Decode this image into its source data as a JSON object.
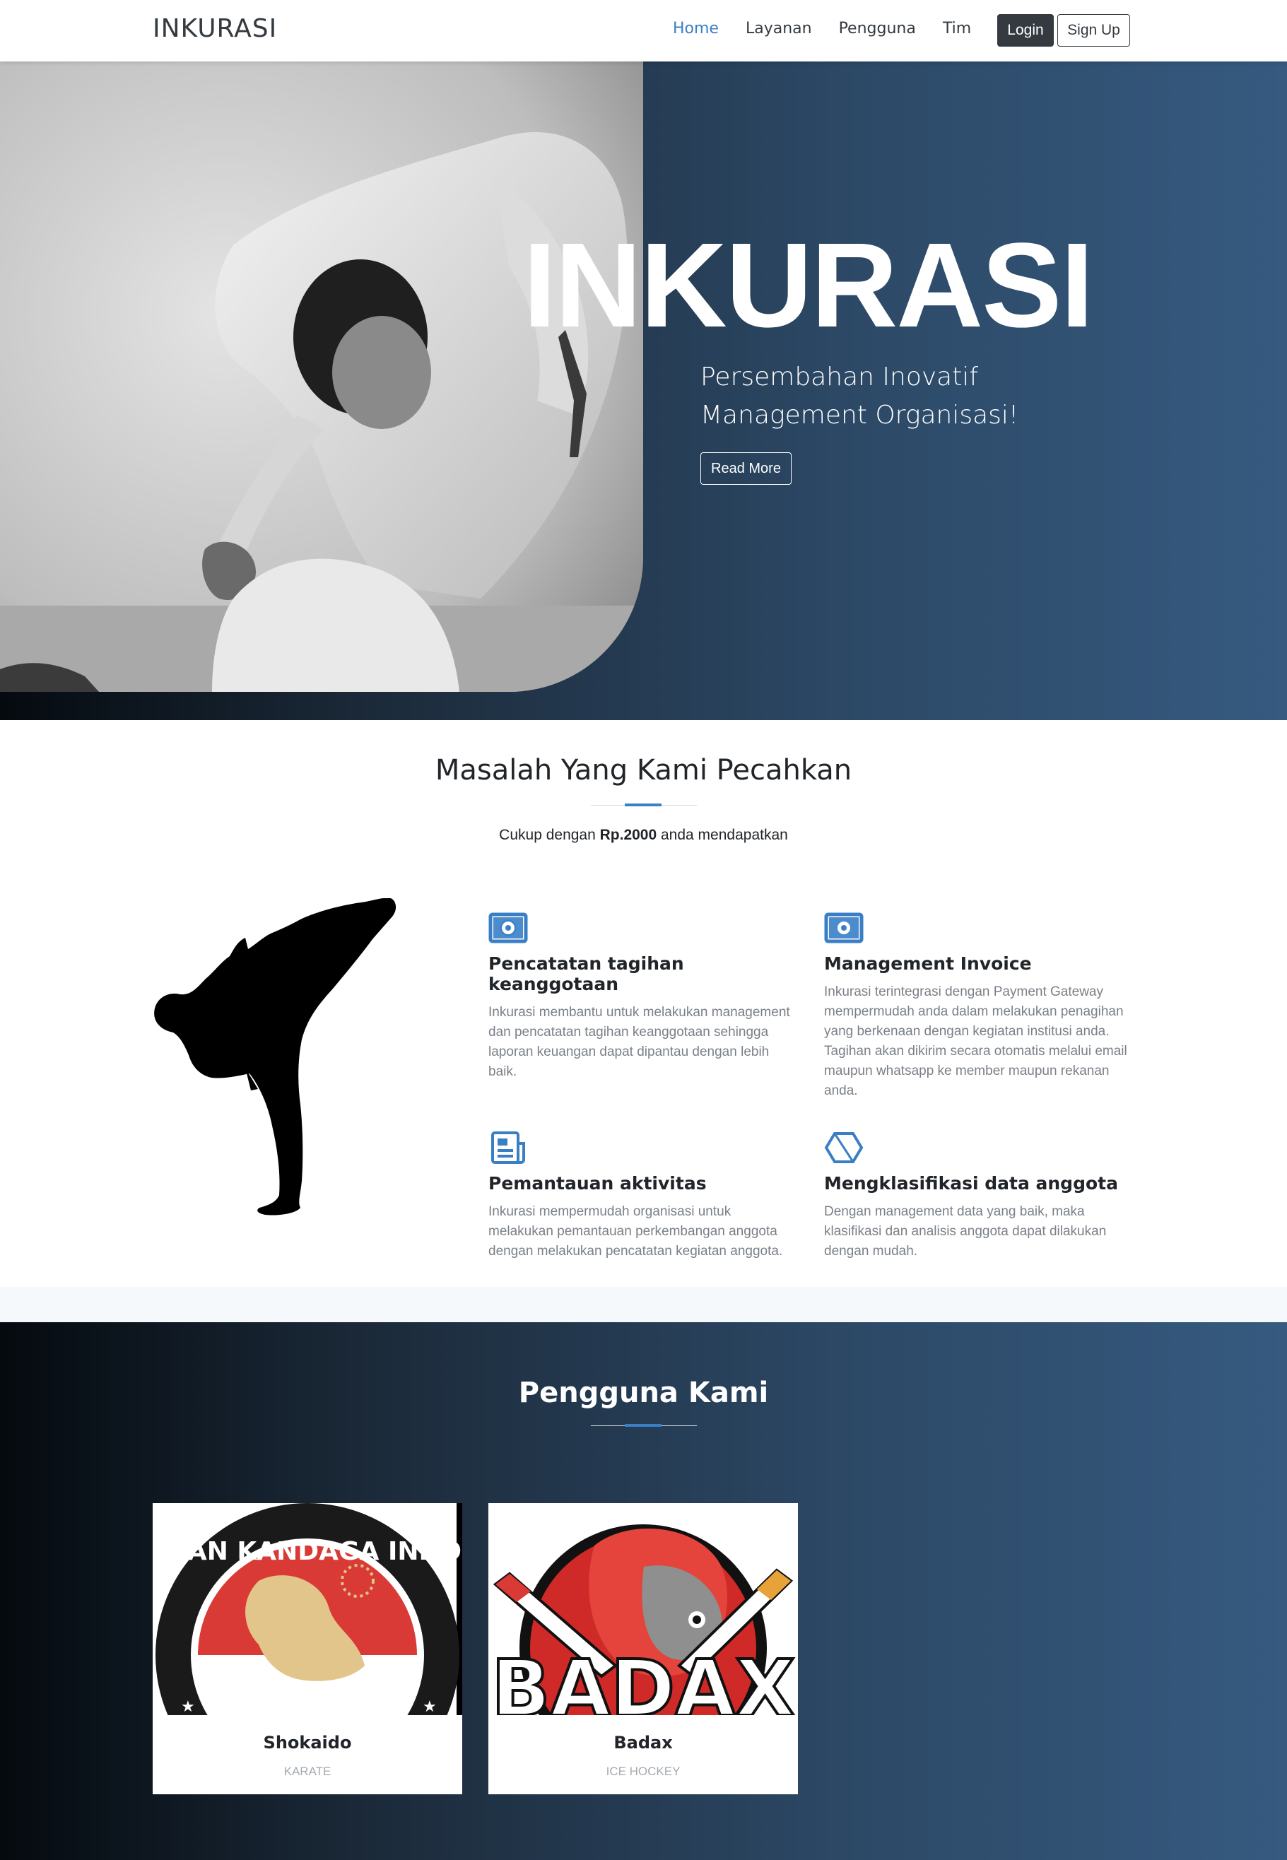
{
  "navbar": {
    "brand": "INKURASI",
    "links": [
      "Home",
      "Layanan",
      "Pengguna",
      "Tim"
    ],
    "active": "Home",
    "login_label": "Login",
    "signup_label": "Sign Up"
  },
  "hero": {
    "title": "INKURASI",
    "subtitle": "Persembahan Inovatif Management Organisasi!",
    "button_label": "Read More"
  },
  "problems": {
    "title": "Masalah Yang Kami Pecahkan",
    "lead_prefix": "Cukup dengan ",
    "lead_price": "Rp.2000",
    "lead_suffix": " anda mendapatkan",
    "features": [
      {
        "icon": "money-icon",
        "title": "Pencatatan tagihan keanggotaan",
        "text": "Inkurasi membantu untuk melakukan management dan pencatatan tagihan keanggotaan sehingga laporan keuangan dapat dipantau dengan lebih baik."
      },
      {
        "icon": "money-icon",
        "title": "Management Invoice",
        "text": "Inkurasi terintegrasi dengan Payment Gateway mempermudah anda dalam melakukan penagihan yang berkenaan dengan kegiatan institusi anda. Tagihan akan dikirim secara otomatis melalui email maupun whatsapp ke member maupun rekanan anda."
      },
      {
        "icon": "newspaper-icon",
        "title": "Pemantauan aktivitas",
        "text": "Inkurasi mempermudah organisasi untuk melakukan pemantauan perkembangan anggota dengan melakukan pencatatan kegiatan anggota."
      },
      {
        "icon": "hexagon-icon",
        "title": "Mengklasifikasi data anggota",
        "text": "Dengan management data yang baik, maka klasifikasi dan analisis anggota dapat dilakukan dengan mudah."
      }
    ]
  },
  "users": {
    "title": "Pengguna Kami",
    "cards": [
      {
        "name": "Shokaido",
        "type": "KARATE",
        "logo_text": "SHOTOKAN KANDAGA INDONESIA"
      },
      {
        "name": "Badax",
        "type": "ICE HOCKEY",
        "logo_text": "BADAX"
      }
    ]
  },
  "colors": {
    "accent": "#3a7fc6",
    "dark": "#343a40",
    "hero_gradient_end": "#365a80"
  }
}
